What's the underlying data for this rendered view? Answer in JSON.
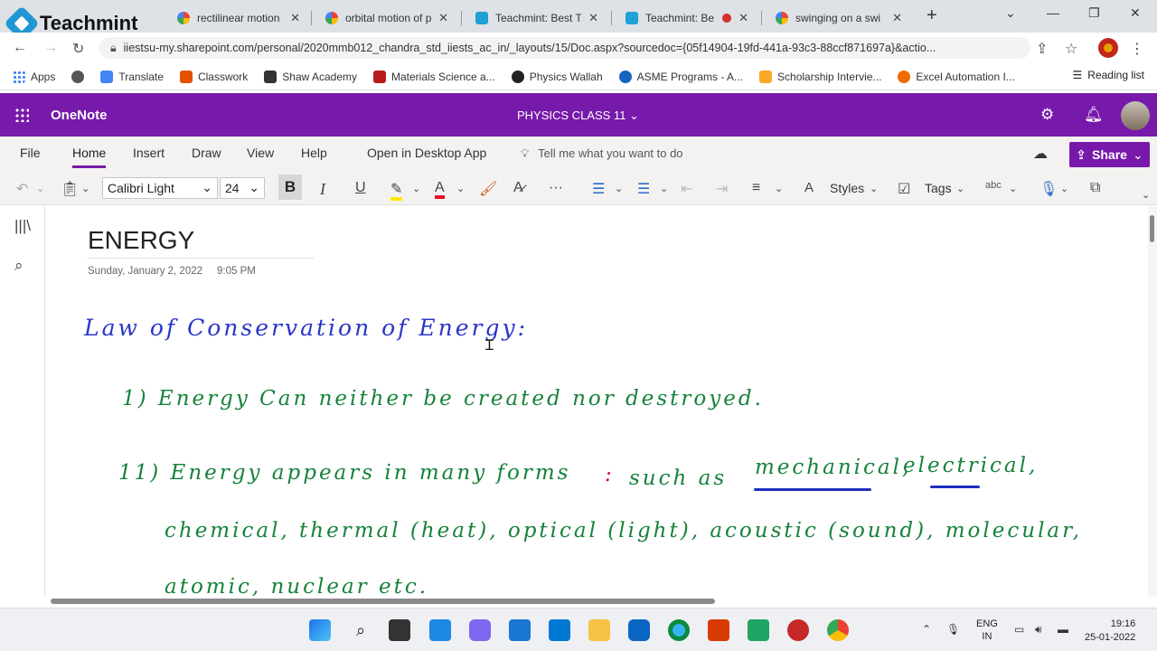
{
  "overlay_logo": {
    "text": "Teachmint"
  },
  "browser": {
    "tabs": [
      {
        "label": "rectilinear motion",
        "favicon": "google-icon"
      },
      {
        "label": "orbital motion of p",
        "favicon": "google-icon"
      },
      {
        "label": "Teachmint: Best Te",
        "favicon": "teachmint-icon"
      },
      {
        "label": "Teachmint: Be",
        "favicon": "teachmint-icon"
      },
      {
        "label": "swinging on a swi",
        "favicon": "google-icon"
      }
    ],
    "url": "iiestsu-my.sharepoint.com/personal/2020mmb012_chandra_std_iiests_ac_in/_layouts/15/Doc.aspx?sourcedoc={05f14904-19fd-441a-93c3-88ccf871697a}&actio...",
    "bookmarks": [
      {
        "label": "Apps",
        "color": "#4285f4"
      },
      {
        "label": "",
        "color": "#555555"
      },
      {
        "label": "Translate",
        "color": "#4285f4"
      },
      {
        "label": "Classwork",
        "color": "#e65100"
      },
      {
        "label": "Shaw Academy",
        "color": "#333333"
      },
      {
        "label": "Materials Science a...",
        "color": "#b71c1c"
      },
      {
        "label": "Physics Wallah",
        "color": "#222222"
      },
      {
        "label": "ASME Programs - A...",
        "color": "#1565c0"
      },
      {
        "label": "Scholarship Intervie...",
        "color": "#f9a825"
      },
      {
        "label": "Excel Automation I...",
        "color": "#ef6c00"
      }
    ],
    "reading_list": "Reading list"
  },
  "onenote": {
    "app_name": "OneNote",
    "notebook": "PHYSICS CLASS 11",
    "menus": [
      "File",
      "Home",
      "Insert",
      "Draw",
      "View",
      "Help"
    ],
    "open_desktop": "Open in Desktop App",
    "tell_me": "Tell me what you want to do",
    "share": "Share",
    "font_name": "Calibri Light",
    "font_size": "24",
    "styles": "Styles",
    "tags": "Tags",
    "accent": "#7719aa"
  },
  "page": {
    "title": "ENERGY",
    "date": "Sunday, January 2, 2022",
    "time": "9:05 PM",
    "heading": "Law of Conservation of Energy:",
    "line1": "1) Energy Can neither be created nor destroyed.",
    "line2_a": "11) Energy appears in many forms",
    "line2_colon": ":",
    "line2_b": "such as",
    "line2_mech": "mechanical,",
    "line2_elec": "electrical,",
    "line3": "chemical, thermal (heat), optical (light), acoustic (sound), molecular,",
    "line4": "atomic, nuclear etc."
  },
  "taskbar": {
    "lang_top": "ENG",
    "lang_bottom": "IN",
    "time": "19:16",
    "date": "25-01-2022"
  }
}
